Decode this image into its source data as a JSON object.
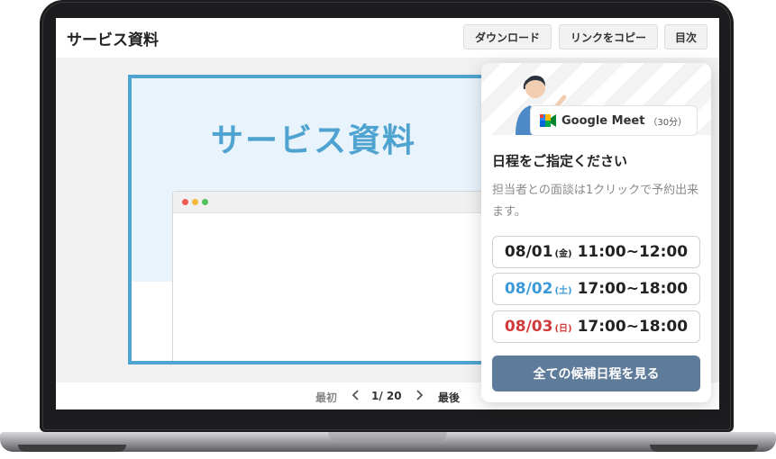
{
  "header": {
    "title": "サービス資料",
    "download_label": "ダウンロード",
    "copy_link_label": "リンクをコピー",
    "toc_label": "目次"
  },
  "slide": {
    "title": "サービス資料",
    "window_dot_colors": [
      "#ee5b53",
      "#f5b83a",
      "#4fc25a"
    ]
  },
  "pager": {
    "first_label": "最初",
    "prev_icon": "chevron-left-icon",
    "page_indicator": "1/ 20",
    "next_icon": "chevron-right-icon",
    "last_label": "最後"
  },
  "booking": {
    "service_name": "Google Meet",
    "duration": "（30分）",
    "heading": "日程をご指定ください",
    "description": "担当者との面談は1クリックで予約出来ます。",
    "slots": [
      {
        "date": "08/01",
        "dow": "(金)",
        "time": "11:00~12:00",
        "color": "#222222"
      },
      {
        "date": "08/02",
        "dow": "(土)",
        "time": "17:00~18:00",
        "color": "#3a9ad9"
      },
      {
        "date": "08/03",
        "dow": "(日)",
        "time": "17:00~18:00",
        "color": "#d03a3a"
      }
    ],
    "cta_label": "全ての候補日程を見る",
    "cta_color": "#5f7b9a"
  }
}
